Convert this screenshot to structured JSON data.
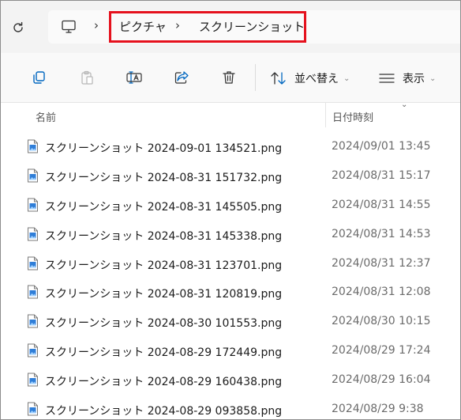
{
  "breadcrumb": {
    "root_icon": "computer-icon",
    "items": [
      "ピクチャ",
      "スクリーンショット"
    ],
    "separator": "›"
  },
  "toolbar": {
    "icons": [
      "copy-icon",
      "paste-icon",
      "rename-icon",
      "share-icon",
      "delete-icon"
    ],
    "sort_label": "並べ替え",
    "view_label": "表示"
  },
  "columns": {
    "name": "名前",
    "date": "日付時刻"
  },
  "files": [
    {
      "name": "スクリーンショット 2024-09-01 134521.png",
      "date": "2024/09/01 13:45"
    },
    {
      "name": "スクリーンショット 2024-08-31 151732.png",
      "date": "2024/08/31 15:17"
    },
    {
      "name": "スクリーンショット 2024-08-31 145505.png",
      "date": "2024/08/31 14:55"
    },
    {
      "name": "スクリーンショット 2024-08-31 145338.png",
      "date": "2024/08/31 14:53"
    },
    {
      "name": "スクリーンショット 2024-08-31 123701.png",
      "date": "2024/08/31 12:37"
    },
    {
      "name": "スクリーンショット 2024-08-31 120819.png",
      "date": "2024/08/31 12:08"
    },
    {
      "name": "スクリーンショット 2024-08-30 101553.png",
      "date": "2024/08/30 10:15"
    },
    {
      "name": "スクリーンショット 2024-08-29 172449.png",
      "date": "2024/08/29 17:24"
    },
    {
      "name": "スクリーンショット 2024-08-29 160438.png",
      "date": "2024/08/29 16:04"
    },
    {
      "name": "スクリーンショット 2024-08-29 093858.png",
      "date": "2024/08/29 9:38"
    }
  ],
  "colors": {
    "highlight": "#e5111d",
    "accent": "#0067c0"
  }
}
